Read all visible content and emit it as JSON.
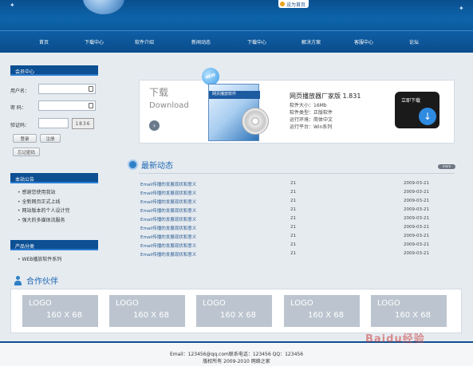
{
  "header": {
    "home_label": "设为首页"
  },
  "nav": {
    "items": [
      "首页",
      "下载中心",
      "软件介绍",
      "新闻动态",
      "下载中心",
      "解决方案",
      "客服中心",
      "论坛"
    ]
  },
  "sidebar": {
    "member_title": "会员中心",
    "username_label": "用户名：",
    "password_label": "密  码：",
    "captcha_label": "验证码：",
    "captcha_value": "1836",
    "login_button": "登录",
    "register_button": "注册",
    "forgot_button": "忘记密码",
    "notice_title": "本站公告",
    "notices": [
      "感谢您使用我站",
      "全新网页正式上线",
      "网站版本的个人设计完",
      "强大的多媒体流服务"
    ],
    "product_title": "产品分类",
    "products": [
      "WEB播放软件系列"
    ]
  },
  "banner": {
    "download_cn": "下载",
    "download_en": "Download",
    "new_badge": "NEW",
    "box_title": "网页播放软件",
    "product_name": "网页播放器厂家版  1.831",
    "info_lines": [
      "软件大小：16Mb",
      "软件类型：正版软件",
      "运行环境：简体中文",
      "运行平台：Win系列"
    ],
    "download_button": "立即下载"
  },
  "news": {
    "title": "最新动态",
    "more": "more",
    "rows": [
      {
        "title": "Email传播的发展现状和意义",
        "count": "21",
        "date": "2009-03-21"
      },
      {
        "title": "Email传播的发展现状和意义",
        "count": "21",
        "date": "2009-03-21"
      },
      {
        "title": "Email传播的发展现状和意义",
        "count": "21",
        "date": "2009-03-21"
      },
      {
        "title": "Email传播的发展现状和意义",
        "count": "21",
        "date": "2009-03-21"
      },
      {
        "title": "Email传播的发展现状和意义",
        "count": "21",
        "date": "2009-03-21"
      },
      {
        "title": "Email传播的发展现状和意义",
        "count": "21",
        "date": "2009-03-21"
      },
      {
        "title": "Email传播的发展现状和意义",
        "count": "21",
        "date": "2009-03-21"
      },
      {
        "title": "Email传播的发展现状和意义",
        "count": "21",
        "date": "2009-03-21"
      },
      {
        "title": "Email传播的发展现状和意义",
        "count": "21",
        "date": "2009-03-21"
      }
    ]
  },
  "partners": {
    "title": "合作伙伴",
    "logos": [
      {
        "logo": "LOGO",
        "size": "160 X 68"
      },
      {
        "logo": "LOGO",
        "size": "160 X 68"
      },
      {
        "logo": "LOGO",
        "size": "160 X 68"
      },
      {
        "logo": "LOGO",
        "size": "160 X 68"
      },
      {
        "logo": "LOGO",
        "size": "160 X 68"
      }
    ]
  },
  "footer": {
    "line1": "Email：123456@qq.com联系电话：123456 QQ：123456",
    "line2": "版权所有 2009-2010 网络之家"
  },
  "watermark": "Baidu经验",
  "colors": {
    "header": "#0b5a9d",
    "nav": "#0a4d8c",
    "accent": "#1d66b3"
  }
}
